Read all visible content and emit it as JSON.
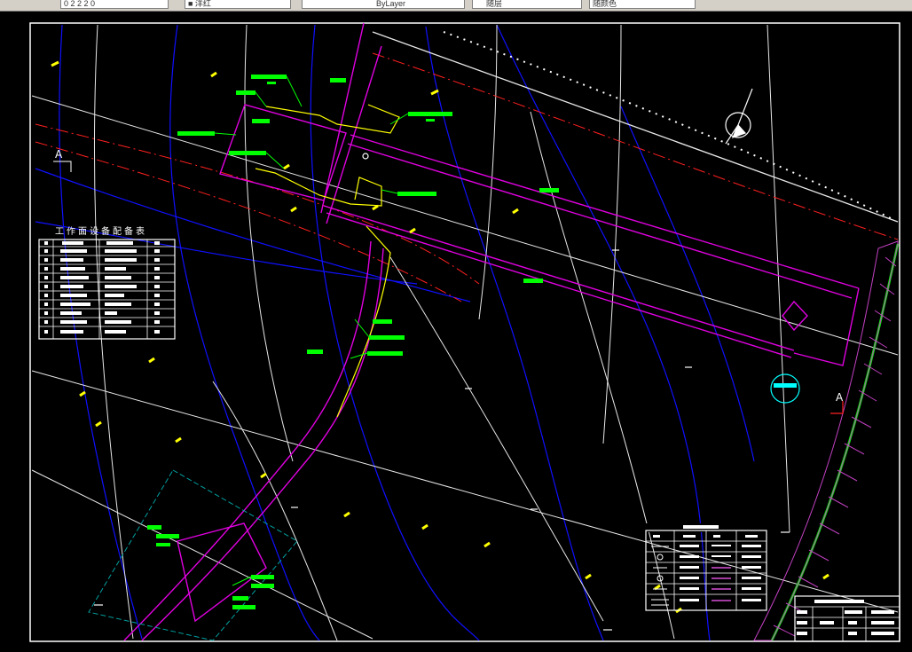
{
  "toolbar": {
    "layer_name": "0 2 2 2 0",
    "color_label": "■ 洋红",
    "linetype_label": "ByLayer",
    "lineweight_label": "随层",
    "plotstyle_label": "随颜色"
  },
  "drawing": {
    "section_mark_left": "A",
    "section_mark_right": "A",
    "equipment_table_title": "工作面设备配备表"
  },
  "colors": {
    "magenta": "#e000e0",
    "yellow": "#ffff00",
    "green": "#00ff00",
    "cyan": "#00ffff",
    "blue": "#1010ff",
    "red": "#ff2020",
    "white": "#ffffff"
  }
}
